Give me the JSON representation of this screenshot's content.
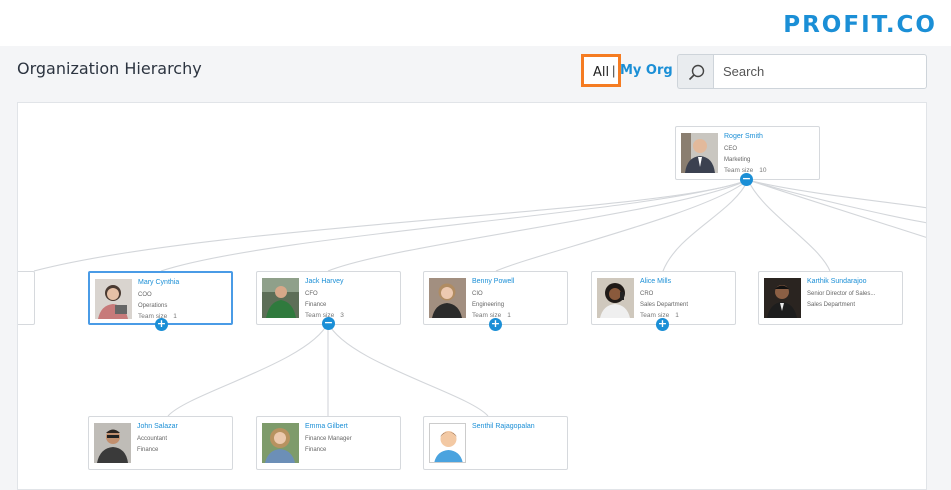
{
  "brand": {
    "logo_text": "PROFIT.CO"
  },
  "page": {
    "title": "Organization Hierarchy"
  },
  "filters": {
    "all": "All",
    "separator": "|",
    "my_org": "My Org"
  },
  "search": {
    "placeholder": "Search",
    "value": ""
  },
  "labels": {
    "team_size": "Team size"
  },
  "nodes": {
    "root": {
      "name": "Roger Smith",
      "role": "CEO",
      "dept": "Marketing",
      "team_size": "10",
      "toggle": "−"
    },
    "mary": {
      "name": "Mary Cynthia",
      "role": "COO",
      "dept": "Operations",
      "team_size": "1",
      "toggle": "+"
    },
    "jack": {
      "name": "Jack Harvey",
      "role": "CFO",
      "dept": "Finance",
      "team_size": "3",
      "toggle": "−"
    },
    "benny": {
      "name": "Benny Powell",
      "role": "CIO",
      "dept": "Engineering",
      "team_size": "1",
      "toggle": "+"
    },
    "alice": {
      "name": "Alice Mills",
      "role": "CRO",
      "dept": "Sales Department",
      "team_size": "1",
      "toggle": "+"
    },
    "karthik": {
      "name": "Karthik Sundarajoo",
      "role": "Senior Director of Sales...",
      "dept": "Sales Department"
    },
    "john": {
      "name": "John Salazar",
      "role": "Accountant",
      "dept": "Finance"
    },
    "emma": {
      "name": "Emma Gilbert",
      "role": "Finance Manager",
      "dept": "Finance"
    },
    "senthil": {
      "name": "Senthil Rajagopalan"
    }
  },
  "colors": {
    "accent": "#1b8fd6",
    "highlight": "#f57c22",
    "selected_border": "#4a9be6"
  }
}
